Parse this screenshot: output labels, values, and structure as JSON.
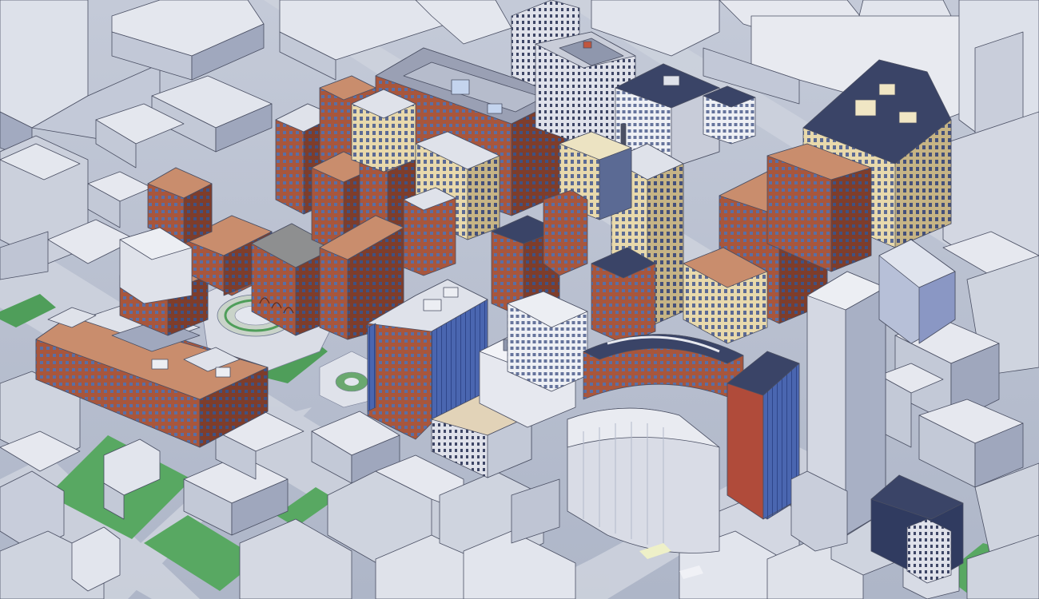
{
  "colors": {
    "ground": "#b9c0cf",
    "street": "#c9ced9",
    "context_roof": "#e3e6ee",
    "context_wall_light": "#c5cbda",
    "context_wall_dark": "#98a0b8",
    "lawn": "#4f9e5a",
    "brick_roof": "#c98d6d",
    "brick_wall": "#a8563c",
    "brick_wall_dark": "#7e3d2b",
    "tan_wall": "#e6d6a8",
    "navy_roof": "#3a4467",
    "window_blue": "#4f6ca8",
    "outline": "#4a4f63"
  },
  "scene": {
    "subject": "isometric-3d-city-block",
    "rendering": "clay-massing-with-textured-landmark-buildings"
  }
}
